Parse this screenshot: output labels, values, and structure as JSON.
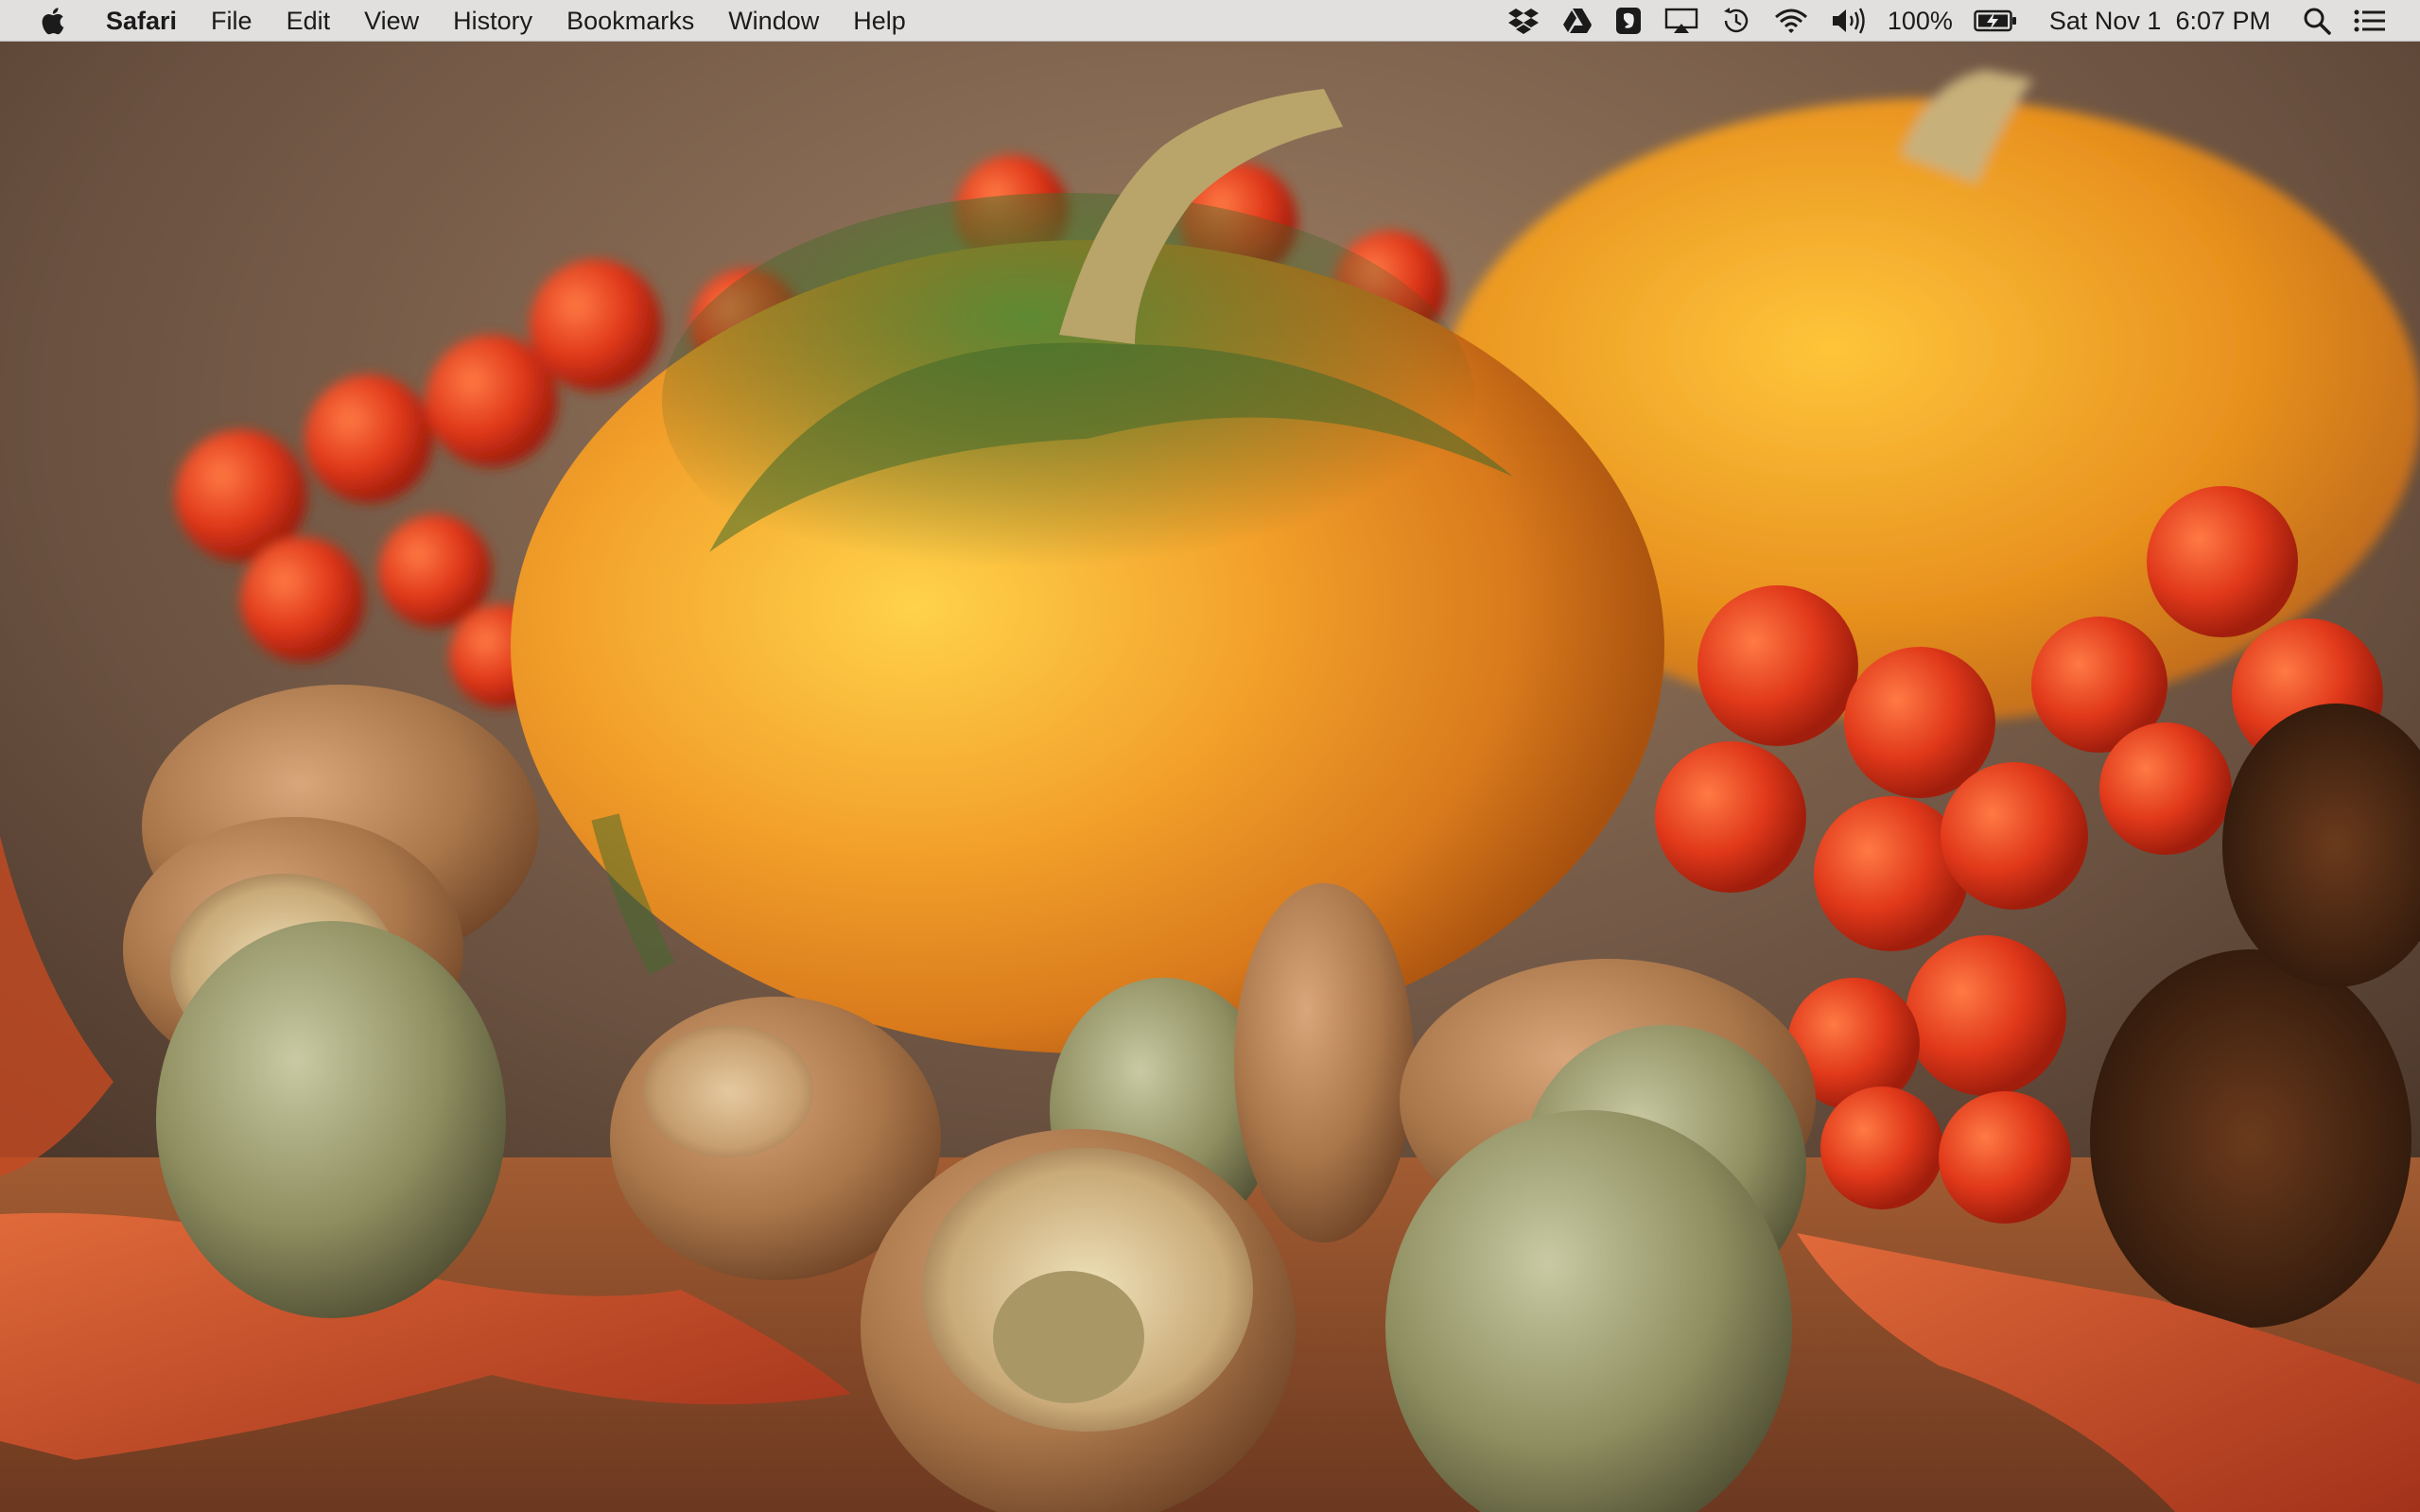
{
  "menubar": {
    "app_name": "Safari",
    "menus": [
      "File",
      "Edit",
      "View",
      "History",
      "Bookmarks",
      "Window",
      "Help"
    ],
    "status": {
      "icons": [
        "dropbox-icon",
        "google-drive-icon",
        "evernote-icon",
        "airplay-icon",
        "time-machine-icon",
        "wifi-icon",
        "volume-icon"
      ],
      "battery_percent": "100%",
      "battery_icon": "battery-charging-icon",
      "datetime": "Sat Nov 1  6:07 PM",
      "spotlight_icon": "spotlight-search-icon",
      "notification_icon": "notification-center-icon"
    }
  },
  "desktop": {
    "wallpaper": "autumn-still-life"
  },
  "colors": {
    "menubar_bg": "#ececec",
    "menubar_text": "#1b1b1b",
    "pumpkin_orange": "#e9922a",
    "gourd_green": "#3f6a2c",
    "berry_red": "#d8341a",
    "acorn_brown": "#a9764a"
  }
}
